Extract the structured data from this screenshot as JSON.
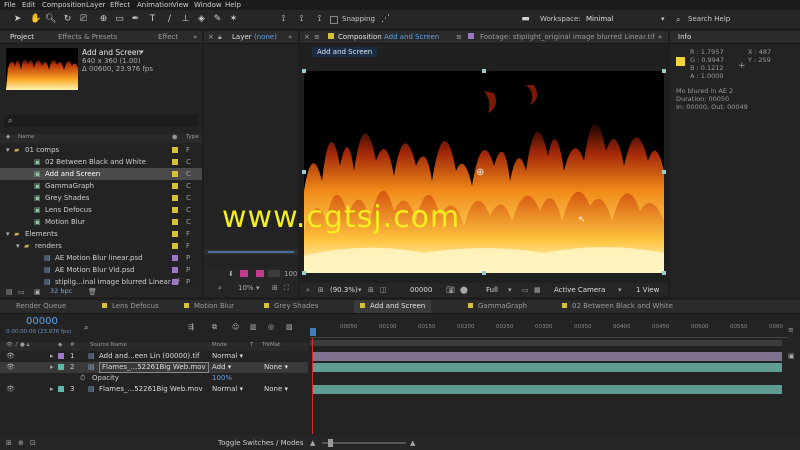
{
  "menu": [
    "File",
    "Edit",
    "Composition",
    "Layer",
    "Effect",
    "Animation",
    "View",
    "Window",
    "Help"
  ],
  "toolbar": {
    "snapping": "Snapping",
    "workspace_label": "Workspace:",
    "workspace_value": "Minimal",
    "search_placeholder": "Search Help"
  },
  "project_panel": {
    "tabs": [
      "Project",
      "Effects & Presets",
      "Effect"
    ],
    "preview_name": "Add and Screen",
    "preview_dims": "640 x 360 (1.00)",
    "preview_dur": "Δ 00600, 23.976 fps",
    "search_icon": "search-icon",
    "col_name": "Name",
    "col_type": "Type",
    "items": [
      {
        "name": "01 comps",
        "kind": "folder",
        "color": "#d8c13a",
        "type": "F"
      },
      {
        "name": "02 Between Black and White",
        "kind": "comp",
        "color": "#d8c13a",
        "type": "C"
      },
      {
        "name": "Add and Screen",
        "kind": "comp",
        "color": "#d8c13a",
        "type": "C"
      },
      {
        "name": "GammaGraph",
        "kind": "comp",
        "color": "#d8c13a",
        "type": "C"
      },
      {
        "name": "Grey Shades",
        "kind": "comp",
        "color": "#d8c13a",
        "type": "C"
      },
      {
        "name": "Lens Defocus",
        "kind": "comp",
        "color": "#d8c13a",
        "type": "C"
      },
      {
        "name": "Motion Blur",
        "kind": "comp",
        "color": "#d8c13a",
        "type": "C"
      },
      {
        "name": "Elements",
        "kind": "folder",
        "color": "#d8c13a",
        "type": "F"
      },
      {
        "name": "renders",
        "kind": "folder",
        "color": "#d8c13a",
        "type": "F"
      },
      {
        "name": "AE Motion Blur linear.psd",
        "kind": "file",
        "color": "#9b77c6",
        "type": "P"
      },
      {
        "name": "AE Motion Blur Vid.psd",
        "kind": "file",
        "color": "#9b77c6",
        "type": "P"
      },
      {
        "name": "stiplig...inal image blurred Linear.tif",
        "kind": "file",
        "color": "#9b77c6",
        "type": "P"
      }
    ],
    "bpc": "32 bpc"
  },
  "layer_panel": {
    "title": "Layer",
    "value": "(none)"
  },
  "comp_panel": {
    "tab_prefix": "Composition",
    "tab_name": "Add and Screen",
    "footage_tab": "Footage: stiplight_original image blurred Linear.tif",
    "breadcrumb": "Add and Screen",
    "zoom": "(90.3%)",
    "timecode": "00000",
    "resolution": "Full",
    "camera": "Active Camera",
    "view": "1 View"
  },
  "layer_footer": {
    "zoom": "10%",
    "mid": "100"
  },
  "info_panel": {
    "title": "Info",
    "r": "R : 1.7957",
    "g": "G : 0.9947",
    "b": "B : 0.1212",
    "a": "A : 1.0000",
    "x": "X : 487",
    "y": "Y : 259",
    "swatch_color": "#f5d63a",
    "line1": "Mo blured in AE 2",
    "line2": "Duration: 00050",
    "line3": "In: 00000, Out: 00049"
  },
  "watermark": "www.cgtsj.com",
  "timeline_tabs": [
    {
      "label": "Render Queue",
      "color": ""
    },
    {
      "label": "Lens Defocus",
      "color": "#d8c13a"
    },
    {
      "label": "Motion Blur",
      "color": "#d8c13a"
    },
    {
      "label": "Grey Shades",
      "color": "#d8c13a"
    },
    {
      "label": "Add and Screen",
      "color": "#d8c13a"
    },
    {
      "label": "GammaGraph",
      "color": "#d8c13a"
    },
    {
      "label": "02 Between Black and White",
      "color": "#d8c13a"
    }
  ],
  "timeline": {
    "timecode": "00000",
    "fps": "0:00:00:00 (23.976 fps)",
    "col_hash": "#",
    "col_source": "Source Name",
    "col_mode": "Mode",
    "col_t": "T",
    "col_trkmat": "TrkMat",
    "ruler": [
      "00050",
      "00100",
      "00150",
      "00200",
      "00250",
      "00300",
      "00350",
      "00400",
      "00450",
      "00500",
      "00550",
      "0060"
    ],
    "layers": [
      {
        "num": "1",
        "name": "Add and...een Lin (00000).tif",
        "mode": "Normal",
        "trkmat": "",
        "color": "#9b77c6",
        "bar": "#7e7290"
      },
      {
        "num": "2",
        "name": "Flames_...52261Big Web.mov",
        "mode": "Add",
        "trkmat": "None",
        "color": "#5fb8a8",
        "bar": "#5f9c93"
      },
      {
        "num": "3",
        "name": "Flames_...52261Big Web.mov",
        "mode": "Normal",
        "trkmat": "None",
        "color": "#5fb8a8",
        "bar": "#5f9c93"
      }
    ],
    "opacity_label": "Opacity",
    "opacity_value": "100%",
    "toggle_label": "Toggle Switches / Modes"
  }
}
